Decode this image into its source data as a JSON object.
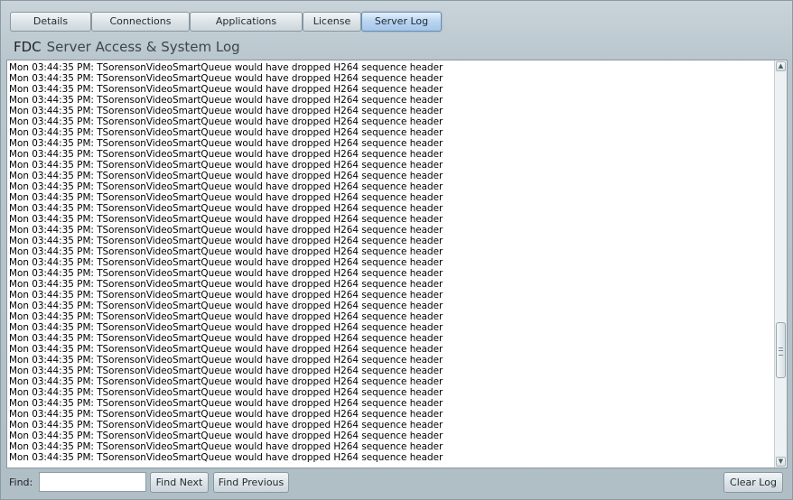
{
  "tabs": [
    {
      "label": "Details"
    },
    {
      "label": "Connections"
    },
    {
      "label": "Applications"
    },
    {
      "label": "License"
    },
    {
      "label": "Server Log",
      "active": true
    }
  ],
  "page": {
    "prefix": "FDC",
    "title": "Server Access & System Log"
  },
  "log": {
    "lines": [
      "Mon 03:44:35 PM: TSorensonVideoSmartQueue would have dropped H264 sequence header",
      "Mon 03:44:35 PM: TSorensonVideoSmartQueue would have dropped H264 sequence header",
      "Mon 03:44:35 PM: TSorensonVideoSmartQueue would have dropped H264 sequence header",
      "Mon 03:44:35 PM: TSorensonVideoSmartQueue would have dropped H264 sequence header",
      "Mon 03:44:35 PM: TSorensonVideoSmartQueue would have dropped H264 sequence header",
      "Mon 03:44:35 PM: TSorensonVideoSmartQueue would have dropped H264 sequence header",
      "Mon 03:44:35 PM: TSorensonVideoSmartQueue would have dropped H264 sequence header",
      "Mon 03:44:35 PM: TSorensonVideoSmartQueue would have dropped H264 sequence header",
      "Mon 03:44:35 PM: TSorensonVideoSmartQueue would have dropped H264 sequence header",
      "Mon 03:44:35 PM: TSorensonVideoSmartQueue would have dropped H264 sequence header",
      "Mon 03:44:35 PM: TSorensonVideoSmartQueue would have dropped H264 sequence header",
      "Mon 03:44:35 PM: TSorensonVideoSmartQueue would have dropped H264 sequence header",
      "Mon 03:44:35 PM: TSorensonVideoSmartQueue would have dropped H264 sequence header",
      "Mon 03:44:35 PM: TSorensonVideoSmartQueue would have dropped H264 sequence header",
      "Mon 03:44:35 PM: TSorensonVideoSmartQueue would have dropped H264 sequence header",
      "Mon 03:44:35 PM: TSorensonVideoSmartQueue would have dropped H264 sequence header",
      "Mon 03:44:35 PM: TSorensonVideoSmartQueue would have dropped H264 sequence header",
      "Mon 03:44:35 PM: TSorensonVideoSmartQueue would have dropped H264 sequence header",
      "Mon 03:44:35 PM: TSorensonVideoSmartQueue would have dropped H264 sequence header",
      "Mon 03:44:35 PM: TSorensonVideoSmartQueue would have dropped H264 sequence header",
      "Mon 03:44:35 PM: TSorensonVideoSmartQueue would have dropped H264 sequence header",
      "Mon 03:44:35 PM: TSorensonVideoSmartQueue would have dropped H264 sequence header",
      "Mon 03:44:35 PM: TSorensonVideoSmartQueue would have dropped H264 sequence header",
      "Mon 03:44:35 PM: TSorensonVideoSmartQueue would have dropped H264 sequence header",
      "Mon 03:44:35 PM: TSorensonVideoSmartQueue would have dropped H264 sequence header",
      "Mon 03:44:35 PM: TSorensonVideoSmartQueue would have dropped H264 sequence header",
      "Mon 03:44:35 PM: TSorensonVideoSmartQueue would have dropped H264 sequence header",
      "Mon 03:44:35 PM: TSorensonVideoSmartQueue would have dropped H264 sequence header",
      "Mon 03:44:35 PM: TSorensonVideoSmartQueue would have dropped H264 sequence header",
      "Mon 03:44:35 PM: TSorensonVideoSmartQueue would have dropped H264 sequence header",
      "Mon 03:44:35 PM: TSorensonVideoSmartQueue would have dropped H264 sequence header",
      "Mon 03:44:35 PM: TSorensonVideoSmartQueue would have dropped H264 sequence header",
      "Mon 03:44:35 PM: TSorensonVideoSmartQueue would have dropped H264 sequence header",
      "Mon 03:44:35 PM: TSorensonVideoSmartQueue would have dropped H264 sequence header",
      "Mon 03:44:35 PM: TSorensonVideoSmartQueue would have dropped H264 sequence header",
      "Mon 03:44:35 PM: TSorensonVideoSmartQueue would have dropped H264 sequence header",
      "Mon 03:44:35 PM: TSorensonVideoSmartQueue would have dropped H264 sequence header"
    ]
  },
  "find": {
    "label": "Find:",
    "value": "",
    "find_next": "Find Next",
    "find_previous": "Find Previous"
  },
  "clear_log": "Clear Log",
  "icons": {
    "scroll_up": "scroll-up-arrow-icon",
    "scroll_down": "scroll-down-arrow-icon",
    "thumb_grip": "grip-icon"
  }
}
